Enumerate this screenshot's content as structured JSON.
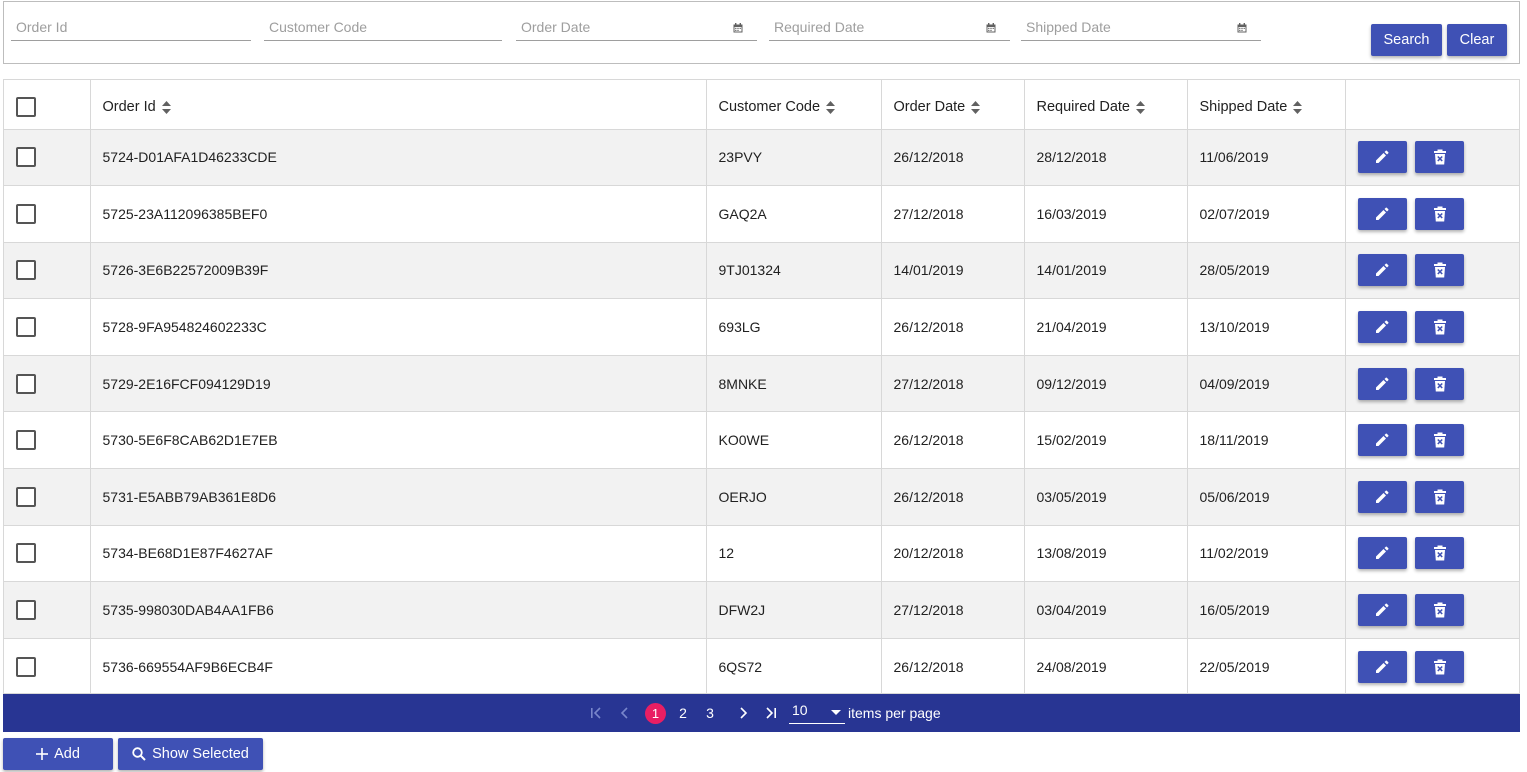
{
  "filters": {
    "order_id_placeholder": "Order Id",
    "customer_code_placeholder": "Customer Code",
    "order_date_placeholder": "Order Date",
    "required_date_placeholder": "Required Date",
    "shipped_date_placeholder": "Shipped Date",
    "search_label": "Search",
    "clear_label": "Clear"
  },
  "table": {
    "columns": [
      "Order Id",
      "Customer Code",
      "Order Date",
      "Required Date",
      "Shipped Date"
    ],
    "rows": [
      {
        "order_id": "5724-D01AFA1D46233CDE",
        "customer": "23PVY",
        "order_date": "26/12/2018",
        "required": "28/12/2018",
        "shipped": "11/06/2019"
      },
      {
        "order_id": "5725-23A112096385BEF0",
        "customer": "GAQ2A",
        "order_date": "27/12/2018",
        "required": "16/03/2019",
        "shipped": "02/07/2019"
      },
      {
        "order_id": "5726-3E6B22572009B39F",
        "customer": "9TJ01324",
        "order_date": "14/01/2019",
        "required": "14/01/2019",
        "shipped": "28/05/2019"
      },
      {
        "order_id": "5728-9FA954824602233C",
        "customer": "693LG",
        "order_date": "26/12/2018",
        "required": "21/04/2019",
        "shipped": "13/10/2019"
      },
      {
        "order_id": "5729-2E16FCF094129D19",
        "customer": "8MNKE",
        "order_date": "27/12/2018",
        "required": "09/12/2019",
        "shipped": "04/09/2019"
      },
      {
        "order_id": "5730-5E6F8CAB62D1E7EB",
        "customer": "KO0WE",
        "order_date": "26/12/2018",
        "required": "15/02/2019",
        "shipped": "18/11/2019"
      },
      {
        "order_id": "5731-E5ABB79AB361E8D6",
        "customer": "OERJO",
        "order_date": "26/12/2018",
        "required": "03/05/2019",
        "shipped": "05/06/2019"
      },
      {
        "order_id": "5734-BE68D1E87F4627AF",
        "customer": "12",
        "order_date": "20/12/2018",
        "required": "13/08/2019",
        "shipped": "11/02/2019"
      },
      {
        "order_id": "5735-998030DAB4AA1FB6",
        "customer": "DFW2J",
        "order_date": "27/12/2018",
        "required": "03/04/2019",
        "shipped": "16/05/2019"
      },
      {
        "order_id": "5736-669554AF9B6ECB4F",
        "customer": "6QS72",
        "order_date": "26/12/2018",
        "required": "24/08/2019",
        "shipped": "22/05/2019"
      }
    ]
  },
  "pager": {
    "pages": [
      "1",
      "2",
      "3"
    ],
    "current_page": "1",
    "page_size": "10",
    "items_per_page_label": "items per page"
  },
  "footer": {
    "add_label": "Add",
    "show_selected_label": "Show Selected"
  },
  "colors": {
    "primary": "#3f51b5",
    "pager_bg": "#283593",
    "current_page": "#e91e63",
    "row_stripe": "#f2f2f2"
  }
}
